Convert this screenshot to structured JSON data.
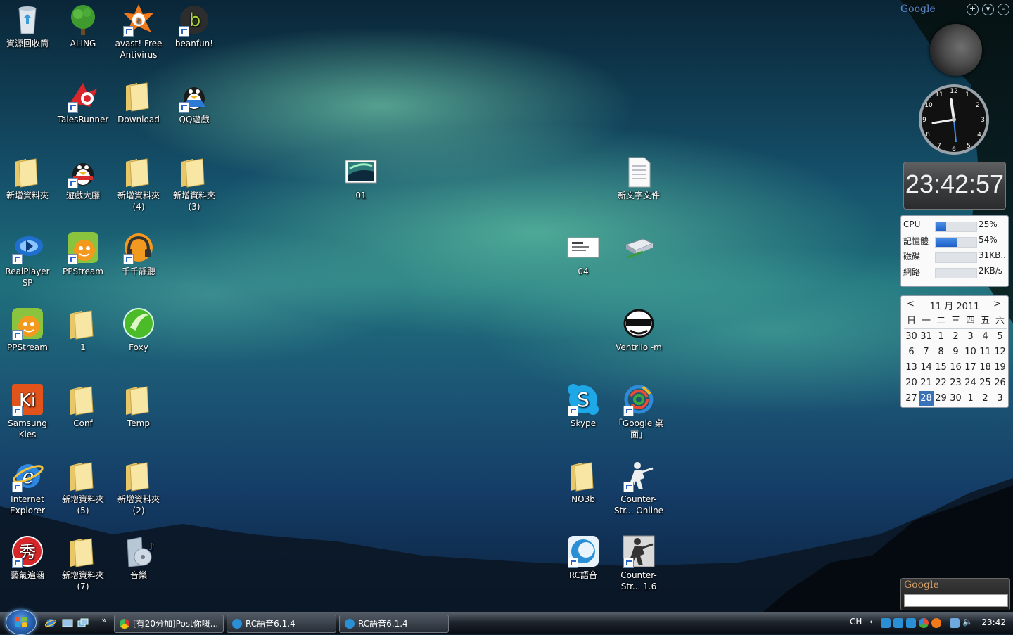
{
  "desktop": {
    "icons": [
      {
        "id": "recycle",
        "label": "資源回收筒",
        "icon": "recycle-bin-icon",
        "shortcut": false
      },
      {
        "id": "aling",
        "label": "ALING",
        "icon": "tree-icon",
        "shortcut": false
      },
      {
        "id": "avast",
        "label": "avast! Free Antivirus",
        "icon": "avast-icon",
        "shortcut": true
      },
      {
        "id": "beanfun",
        "label": "beanfun!",
        "icon": "beanfun-icon",
        "shortcut": true
      },
      {
        "id": "talesrunner",
        "label": "TalesRunner",
        "icon": "talesrunner-icon",
        "shortcut": true
      },
      {
        "id": "download",
        "label": "Download",
        "icon": "folder-icon",
        "shortcut": false
      },
      {
        "id": "qqgame",
        "label": "QQ遊戲",
        "icon": "qq-penguin-icon",
        "shortcut": true
      },
      {
        "id": "newfolder1",
        "label": "新增資料夾",
        "icon": "folder-icon",
        "shortcut": false
      },
      {
        "id": "gamehall",
        "label": "遊戲大廳",
        "icon": "qq-penguin-icon",
        "shortcut": true
      },
      {
        "id": "newfolder4",
        "label": "新增資料夾 (4)",
        "icon": "folder-icon",
        "shortcut": false
      },
      {
        "id": "newfolder3",
        "label": "新增資料夾 (3)",
        "icon": "folder-icon",
        "shortcut": false
      },
      {
        "id": "img01",
        "label": "01",
        "icon": "image-file-icon",
        "shortcut": false
      },
      {
        "id": "newtext",
        "label": "新文字文件",
        "icon": "text-file-icon",
        "shortcut": false
      },
      {
        "id": "realplayer",
        "label": "RealPlayer SP",
        "icon": "realplayer-icon",
        "shortcut": true
      },
      {
        "id": "ppstream1",
        "label": "PPStream",
        "icon": "ppstream-icon",
        "shortcut": true
      },
      {
        "id": "ttplayer",
        "label": "千千靜聽",
        "icon": "headphones-icon",
        "shortcut": true
      },
      {
        "id": "img04",
        "label": "04",
        "icon": "image-file-icon",
        "shortcut": false
      },
      {
        "id": "drive",
        "label": "",
        "icon": "hard-drive-icon",
        "shortcut": false
      },
      {
        "id": "ppstream2",
        "label": "PPStream",
        "icon": "ppstream-icon",
        "shortcut": true
      },
      {
        "id": "folder1",
        "label": "1",
        "icon": "folder-icon",
        "shortcut": false
      },
      {
        "id": "foxy",
        "label": "Foxy",
        "icon": "foxy-icon",
        "shortcut": false
      },
      {
        "id": "ventrilo",
        "label": "Ventrilo -m",
        "icon": "ventrilo-icon",
        "shortcut": false
      },
      {
        "id": "kies",
        "label": "Samsung Kies",
        "icon": "kies-icon",
        "shortcut": true
      },
      {
        "id": "conf",
        "label": "Conf",
        "icon": "folder-icon",
        "shortcut": false
      },
      {
        "id": "temp",
        "label": "Temp",
        "icon": "folder-icon",
        "shortcut": false
      },
      {
        "id": "skype",
        "label": "Skype",
        "icon": "skype-icon",
        "shortcut": true
      },
      {
        "id": "googledesktop",
        "label": "「Google 桌面」",
        "icon": "google-desktop-icon",
        "shortcut": true
      },
      {
        "id": "ie",
        "label": "Internet Explorer",
        "icon": "internet-explorer-icon",
        "shortcut": true
      },
      {
        "id": "newfolder5",
        "label": "新增資料夾 (5)",
        "icon": "folder-icon",
        "shortcut": false
      },
      {
        "id": "newfolder2",
        "label": "新增資料夾 (2)",
        "icon": "folder-icon",
        "shortcut": false
      },
      {
        "id": "no3b",
        "label": "NO3b",
        "icon": "folder-icon",
        "shortcut": false
      },
      {
        "id": "csonline",
        "label": "Counter-Str... Online",
        "icon": "counter-strike-icon",
        "shortcut": true
      },
      {
        "id": "xiu",
        "label": "藝氣遍涵",
        "icon": "xiu-icon",
        "shortcut": true
      },
      {
        "id": "newfolder7",
        "label": "新增資料夾 (7)",
        "icon": "folder-icon",
        "shortcut": false
      },
      {
        "id": "music",
        "label": "音樂",
        "icon": "music-folder-icon",
        "shortcut": false
      },
      {
        "id": "rc",
        "label": "RC語音",
        "icon": "rc-voice-icon",
        "shortcut": true
      },
      {
        "id": "cs16",
        "label": "Counter-Str... 1.6",
        "icon": "counter-strike-icon",
        "shortcut": true
      }
    ]
  },
  "sidebar": {
    "logo": "Google",
    "buttons": {
      "add": "+",
      "options": "▾",
      "minimize": "–"
    },
    "clock_time": "23:42:57",
    "meter": [
      {
        "label": "CPU",
        "value": "25%",
        "fill": 0.25
      },
      {
        "label": "記憶體",
        "value": "54%",
        "fill": 0.54
      },
      {
        "label": "磁碟",
        "value": "31KB..",
        "fill": 0.02
      },
      {
        "label": "網路",
        "value": "2KB/s",
        "fill": 0.0
      }
    ],
    "calendar": {
      "title": "11 月 2011",
      "prev": "<",
      "next": ">",
      "weekdays": [
        "日",
        "一",
        "二",
        "三",
        "四",
        "五",
        "六"
      ],
      "weeks": [
        [
          "30",
          "31",
          "1",
          "2",
          "3",
          "4",
          "5"
        ],
        [
          "6",
          "7",
          "8",
          "9",
          "10",
          "11",
          "12"
        ],
        [
          "13",
          "14",
          "15",
          "16",
          "17",
          "18",
          "19"
        ],
        [
          "20",
          "21",
          "22",
          "23",
          "24",
          "25",
          "26"
        ],
        [
          "27",
          "28",
          "29",
          "30",
          "1",
          "2",
          "3"
        ]
      ],
      "selected": "28"
    },
    "search_logo": "Google",
    "search_value": ""
  },
  "taskbar": {
    "quicklaunch_more": "»",
    "tasks": [
      {
        "label": "[有20分加]Post你嘅...",
        "icon": "chrome-icon"
      },
      {
        "label": "RC語音6.1.4",
        "icon": "rc-voice-icon"
      },
      {
        "label": "RC語音6.1.4",
        "icon": "rc-voice-icon"
      }
    ],
    "language": "CH",
    "time": "23:42"
  },
  "colors": {
    "accent": "#3a72b8",
    "meter_fill": "#1e5fc8"
  }
}
